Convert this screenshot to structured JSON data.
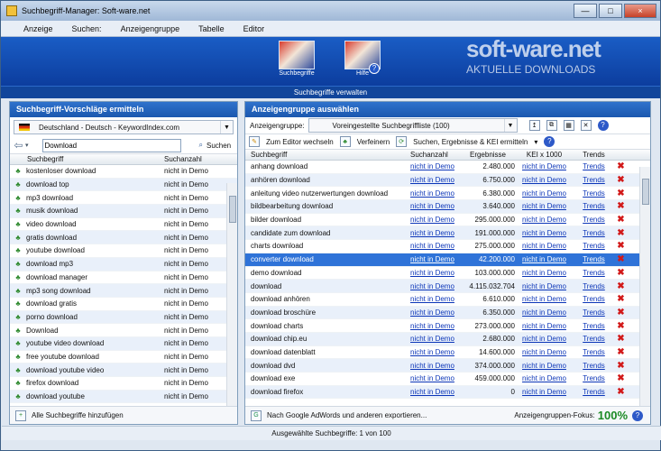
{
  "window": {
    "title": "Suchbegriff-Manager: Soft-ware.net"
  },
  "menu": [
    "Anzeige",
    "Suchen:",
    "Anzeigengruppe",
    "Tabelle",
    "Editor"
  ],
  "banner": {
    "watermark": "soft-ware.net",
    "watermark_sub": "AKTUELLE DOWNLOADS",
    "buttons": [
      {
        "label": "Suchbegriffe",
        "icon": "people-icon"
      },
      {
        "label": "Hilfe",
        "icon": "help-people-icon"
      }
    ],
    "subtitle": "Suchbegriffe verwalten"
  },
  "left_panel": {
    "title": "Suchbegriff-Vorschläge ermitteln",
    "source": "Deutschland - Deutsch - KeywordIndex.com",
    "search_value": "Download",
    "search_button": "Suchen",
    "columns": [
      "Suchbegriff",
      "Suchanzahl"
    ],
    "rows": [
      [
        "kostenloser download",
        "nicht in Demo"
      ],
      [
        "download top",
        "nicht in Demo"
      ],
      [
        "mp3 download",
        "nicht in Demo"
      ],
      [
        "musik download",
        "nicht in Demo"
      ],
      [
        "video download",
        "nicht in Demo"
      ],
      [
        "gratis download",
        "nicht in Demo"
      ],
      [
        "youtube download",
        "nicht in Demo"
      ],
      [
        "download mp3",
        "nicht in Demo"
      ],
      [
        "download manager",
        "nicht in Demo"
      ],
      [
        "mp3 song download",
        "nicht in Demo"
      ],
      [
        "download gratis",
        "nicht in Demo"
      ],
      [
        "porno download",
        "nicht in Demo"
      ],
      [
        "Download",
        "nicht in Demo"
      ],
      [
        "youtube video download",
        "nicht in Demo"
      ],
      [
        "free youtube download",
        "nicht in Demo"
      ],
      [
        "download youtube video",
        "nicht in Demo"
      ],
      [
        "firefox download",
        "nicht in Demo"
      ],
      [
        "download youtube",
        "nicht in Demo"
      ]
    ],
    "footer_button": "Alle Suchbegriffe hinzufügen"
  },
  "right_panel": {
    "title": "Anzeigengruppe auswählen",
    "group_label": "Anzeigengruppe:",
    "group_value": "Voreingestellte Suchbegriffliste (100)",
    "toolbar": [
      "Zum Editor wechseln",
      "Verfeinern",
      "Suchen, Ergebnisse & KEI ermitteln"
    ],
    "columns": [
      "Suchbegriff",
      "Suchanzahl",
      "Ergebnisse",
      "KEI x 1000",
      "Trends"
    ],
    "rows": [
      [
        "anhang download",
        "nicht in Demo",
        "2.480.000",
        "nicht in Demo",
        "Trends"
      ],
      [
        "anhören download",
        "nicht in Demo",
        "6.750.000",
        "nicht in Demo",
        "Trends"
      ],
      [
        "anleitung video nutzerwertungen download",
        "nicht in Demo",
        "6.380.000",
        "nicht in Demo",
        "Trends"
      ],
      [
        "bildbearbeitung download",
        "nicht in Demo",
        "3.640.000",
        "nicht in Demo",
        "Trends"
      ],
      [
        "bilder download",
        "nicht in Demo",
        "295.000.000",
        "nicht in Demo",
        "Trends"
      ],
      [
        "candidate zum download",
        "nicht in Demo",
        "191.000.000",
        "nicht in Demo",
        "Trends"
      ],
      [
        "charts download",
        "nicht in Demo",
        "275.000.000",
        "nicht in Demo",
        "Trends"
      ],
      [
        "converter download",
        "nicht in Demo",
        "42.200.000",
        "nicht in Demo",
        "Trends"
      ],
      [
        "demo download",
        "nicht in Demo",
        "103.000.000",
        "nicht in Demo",
        "Trends"
      ],
      [
        "download",
        "nicht in Demo",
        "4.115.032.704",
        "nicht in Demo",
        "Trends"
      ],
      [
        "download anhören",
        "nicht in Demo",
        "6.610.000",
        "nicht in Demo",
        "Trends"
      ],
      [
        "download broschüre",
        "nicht in Demo",
        "6.350.000",
        "nicht in Demo",
        "Trends"
      ],
      [
        "download charts",
        "nicht in Demo",
        "273.000.000",
        "nicht in Demo",
        "Trends"
      ],
      [
        "download chip.eu",
        "nicht in Demo",
        "2.680.000",
        "nicht in Demo",
        "Trends"
      ],
      [
        "download datenblatt",
        "nicht in Demo",
        "14.600.000",
        "nicht in Demo",
        "Trends"
      ],
      [
        "download dvd",
        "nicht in Demo",
        "374.000.000",
        "nicht in Demo",
        "Trends"
      ],
      [
        "download exe",
        "nicht in Demo",
        "459.000.000",
        "nicht in Demo",
        "Trends"
      ],
      [
        "download firefox",
        "nicht in Demo",
        "0",
        "nicht in Demo",
        "Trends"
      ]
    ],
    "footer_export": "Nach Google AdWords und anderen exportieren...",
    "focus_label": "Anzeigengruppen-Fokus:",
    "focus_value": "100%"
  },
  "status": "Ausgewählte Suchbegriffe: 1 von 100"
}
